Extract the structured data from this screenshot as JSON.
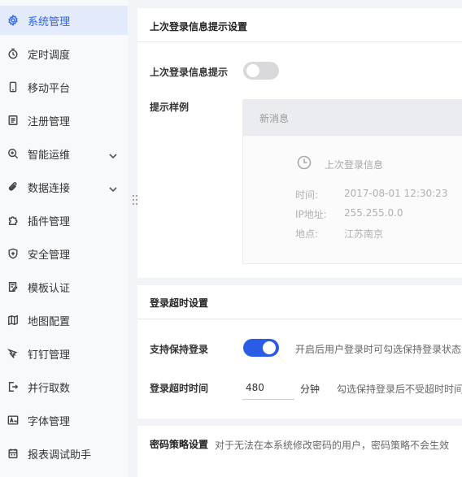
{
  "sidebar": {
    "items": [
      {
        "label": "系统管理",
        "icon": "gear-icon",
        "active": true
      },
      {
        "label": "定时调度",
        "icon": "timer-icon"
      },
      {
        "label": "移动平台",
        "icon": "mobile-icon"
      },
      {
        "label": "注册管理",
        "icon": "register-icon"
      },
      {
        "label": "智能运维",
        "icon": "ops-icon",
        "expandable": true
      },
      {
        "label": "数据连接",
        "icon": "paperclip-icon",
        "expandable": true
      },
      {
        "label": "插件管理",
        "icon": "puzzle-icon"
      },
      {
        "label": "安全管理",
        "icon": "shield-icon"
      },
      {
        "label": "模板认证",
        "icon": "template-cert-icon"
      },
      {
        "label": "地图配置",
        "icon": "map-icon"
      },
      {
        "label": "钉钉管理",
        "icon": "dingtalk-icon"
      },
      {
        "label": "并行取数",
        "icon": "parallel-icon"
      },
      {
        "label": "字体管理",
        "icon": "font-icon"
      },
      {
        "label": "报表调试助手",
        "icon": "debug-icon"
      }
    ]
  },
  "last_login": {
    "title": "上次登录信息提示设置",
    "toggle_label": "上次登录信息提示",
    "toggle_on": false,
    "sample_label": "提示样例",
    "sample": {
      "header": "新消息",
      "message_title": "上次登录信息",
      "rows": [
        {
          "key": "时间:",
          "value": "2017-08-01 12:30:23"
        },
        {
          "key": "IP地址:",
          "value": "255.255.0.0"
        },
        {
          "key": "地点:",
          "value": "江苏南京"
        }
      ]
    }
  },
  "timeout": {
    "title": "登录超时设置",
    "keep_label": "支持保持登录",
    "keep_on": true,
    "keep_hint": "开启后用户登录时可勾选保持登录状态",
    "time_label": "登录超时时间",
    "time_value": "480",
    "time_unit": "分钟",
    "time_hint": "勾选保持登录后不受超时时间"
  },
  "password": {
    "title": "密码策略设置",
    "hint": "对于无法在本系统修改密码的用户，密码策略不会生效"
  },
  "colors": {
    "accent": "#2b5ce6",
    "active_bg": "#e2eafc"
  }
}
